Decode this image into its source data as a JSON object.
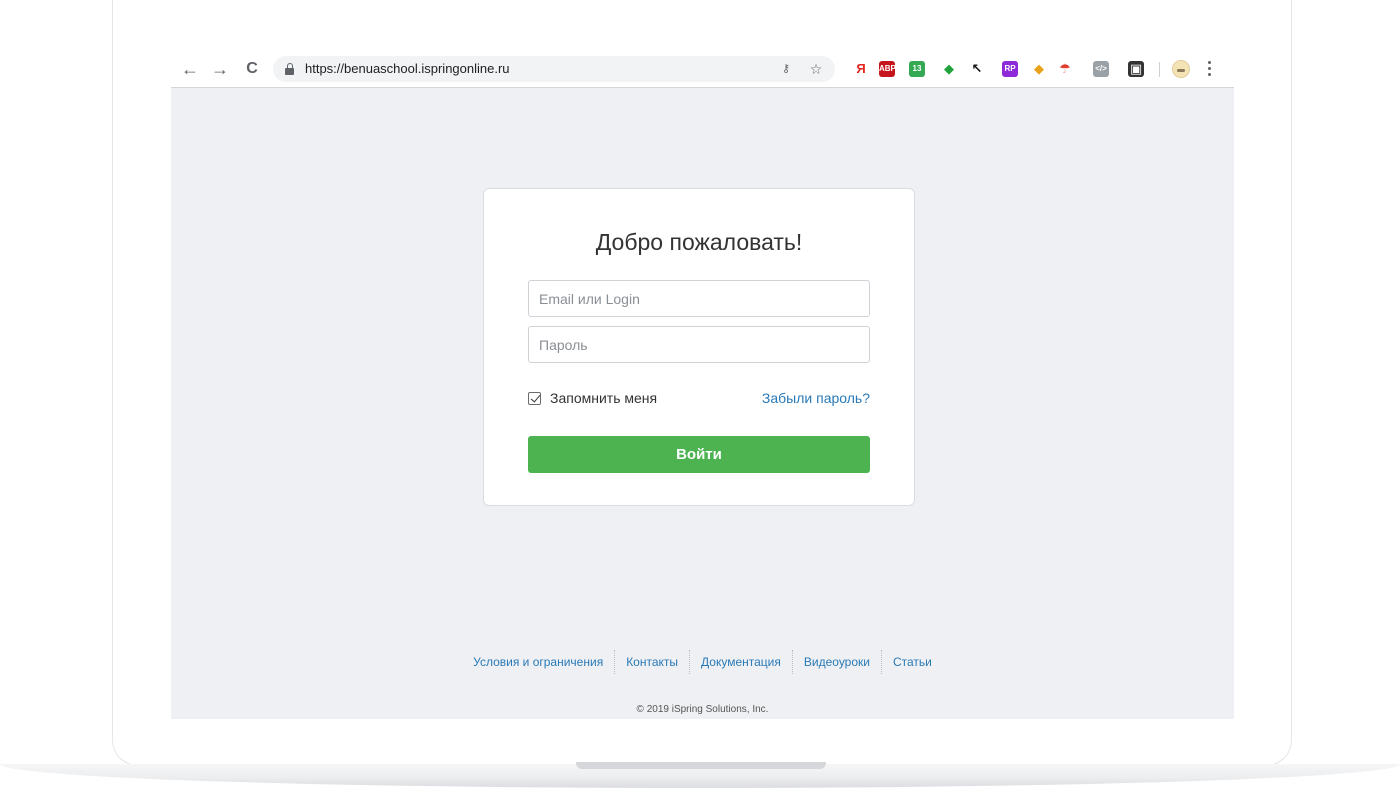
{
  "browser": {
    "url": "https://benuaschool.ispringonline.ru",
    "nav": {
      "back": "←",
      "forward": "→",
      "reload": "C"
    },
    "omnibox_icons": {
      "key": "🔑",
      "star": "☆"
    },
    "extensions": [
      {
        "name": "yandex-icon",
        "glyph": "Я",
        "bg": "#ffffff",
        "fg": "#e52620"
      },
      {
        "name": "adblock-plus-icon",
        "glyph": "ABP",
        "bg": "#c4161c",
        "fg": "#ffffff"
      },
      {
        "name": "green-circle-extension-icon",
        "glyph": "13",
        "bg": "#34a853",
        "fg": "#ffffff"
      },
      {
        "name": "evernote-icon",
        "glyph": "◆",
        "bg": "#ffffff",
        "fg": "#1fa33b"
      },
      {
        "name": "pointer-extension-icon",
        "glyph": "↖",
        "bg": "#ffffff",
        "fg": "#111111"
      },
      {
        "name": "rp-extension-icon",
        "glyph": "RP",
        "bg": "#8e2bd8",
        "fg": "#ffffff"
      },
      {
        "name": "color-picker-icon",
        "glyph": "◆",
        "bg": "#ffffff",
        "fg": "#e8a21a"
      },
      {
        "name": "umbrella-extension-icon",
        "glyph": "☂",
        "bg": "#ffffff",
        "fg": "#e03b2b"
      },
      {
        "name": "code-extension-icon",
        "glyph": "</>",
        "bg": "#9aa2a8",
        "fg": "#ffffff"
      },
      {
        "name": "dark-reader-icon",
        "glyph": "▣",
        "bg": "#333333",
        "fg": "#ffffff"
      }
    ]
  },
  "login": {
    "title": "Добро пожаловать!",
    "email_placeholder": "Email или Login",
    "password_placeholder": "Пароль",
    "remember_label": "Запомнить меня",
    "remember_checked": true,
    "forgot_label": "Забыли пароль?",
    "submit_label": "Войти"
  },
  "footer": {
    "links": [
      "Условия и ограничения",
      "Контакты",
      "Документация",
      "Видеоуроки",
      "Статьи"
    ],
    "copyright": "© 2019 iSpring Solutions, Inc."
  },
  "colors": {
    "accent_green": "#4db351",
    "link_blue": "#2a7ab7",
    "page_bg": "#eef0f3"
  }
}
